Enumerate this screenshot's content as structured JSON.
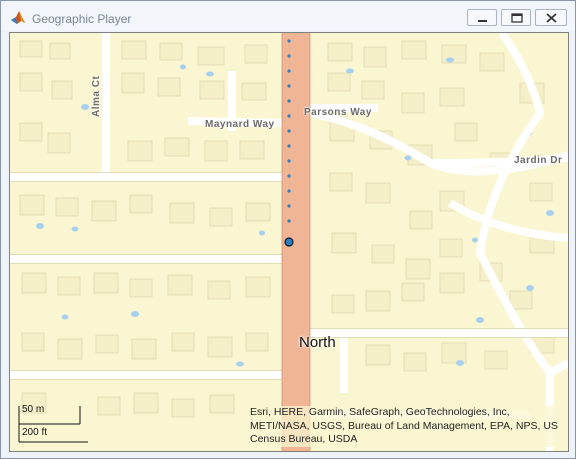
{
  "window": {
    "title": "Geographic Player",
    "icon": "matlab-icon",
    "controls": [
      "minimize-icon",
      "maximize-icon",
      "close-icon"
    ]
  },
  "map": {
    "streets": {
      "alma": "Alma Ct",
      "maynard": "Maynard Way",
      "parsons": "Parsons Way",
      "jardin": "Jardin Dr",
      "north": "North"
    },
    "scale": {
      "metric": "50 m",
      "imperial": "200 ft"
    },
    "attribution": "Esri, HERE, Garmin, SafeGraph, GeoTechnologies, Inc, METI/NASA, USGS, Bureau of Land Management, EPA, NPS, US Census Bureau, USDA",
    "colors": {
      "land": "#faf6d2",
      "road": "#ffffff",
      "arterial": "#f0b595",
      "building": "#f5efc9",
      "water": "#a8d0ee",
      "track": "#2f7fc1"
    }
  }
}
